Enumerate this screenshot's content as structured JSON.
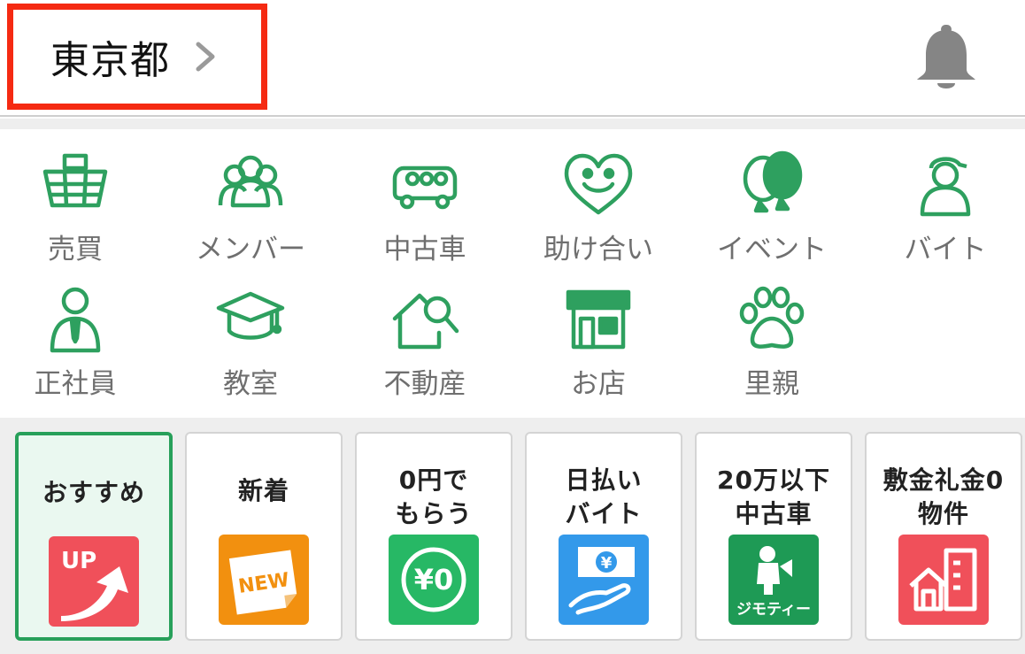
{
  "header": {
    "location": "東京都",
    "icons": {
      "chevron": "chevron-right-icon",
      "notifications": "bell-icon"
    }
  },
  "categories": [
    {
      "id": "buy-sell",
      "label": "売買",
      "icon": "basket-icon"
    },
    {
      "id": "members",
      "label": "メンバー",
      "icon": "people-icon"
    },
    {
      "id": "used-car",
      "label": "中古車",
      "icon": "car-icon"
    },
    {
      "id": "mutual-help",
      "label": "助け合い",
      "icon": "heart-smile-icon"
    },
    {
      "id": "event",
      "label": "イベント",
      "icon": "balloons-icon"
    },
    {
      "id": "part-time",
      "label": "バイト",
      "icon": "worker-cap-icon"
    },
    {
      "id": "full-time",
      "label": "正社員",
      "icon": "businessman-icon"
    },
    {
      "id": "classroom",
      "label": "教室",
      "icon": "graduation-cap-icon"
    },
    {
      "id": "real-estate",
      "label": "不動産",
      "icon": "house-search-icon"
    },
    {
      "id": "shop",
      "label": "お店",
      "icon": "storefront-icon"
    },
    {
      "id": "pet-adoption",
      "label": "里親",
      "icon": "paw-icon"
    }
  ],
  "cards": [
    {
      "id": "recommended",
      "label": "おすすめ",
      "icon": "up-arrow-icon",
      "badge": "UP",
      "color": "#f0505a",
      "active": true
    },
    {
      "id": "new",
      "label": "新着",
      "icon": "new-sticker-icon",
      "badge": "NEW",
      "color": "#f2900f",
      "active": false
    },
    {
      "id": "free",
      "label": "0円で\nもらう",
      "icon": "yen-zero-icon",
      "badge": "¥0",
      "color": "#27b865",
      "active": false
    },
    {
      "id": "daily-pay",
      "label": "日払い\nバイト",
      "icon": "yen-hand-icon",
      "badge": "¥",
      "color": "#3399ea",
      "active": false
    },
    {
      "id": "cheap-car",
      "label": "20万以下\n中古車",
      "icon": "jmty-logo-icon",
      "badge": "ジモティー",
      "color": "#1e9a55",
      "active": false
    },
    {
      "id": "no-deposit",
      "label": "敷金礼金0\n物件",
      "icon": "building-icon",
      "badge": "",
      "color": "#f0505a",
      "active": false
    }
  ],
  "colors": {
    "accent": "#2ea05f",
    "highlight": "#f52a12",
    "label": "#6f6f6f"
  }
}
